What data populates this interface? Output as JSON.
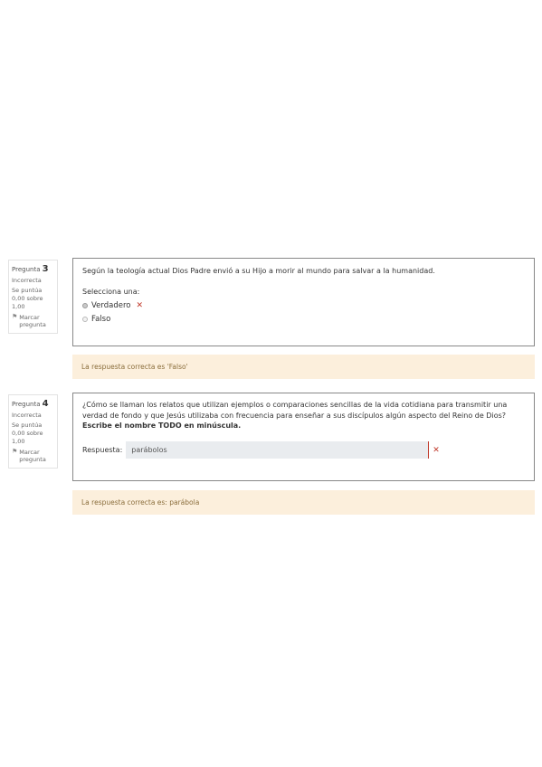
{
  "questions": [
    {
      "title_word": "Pregunta",
      "number": "3",
      "state": "Incorrecta",
      "grade": "Se puntúa 0,00 sobre 1,00",
      "flag_label": "Marcar pregunta",
      "text": "Según la teología actual Dios Padre envió a su Hijo a morir al mundo para salvar a la humanidad.",
      "prompt": "Selecciona una:",
      "options": [
        {
          "label": "Verdadero",
          "selected": true,
          "marked_wrong": true
        },
        {
          "label": "Falso",
          "selected": false,
          "marked_wrong": false
        }
      ],
      "feedback": "La respuesta correcta es 'Falso'"
    },
    {
      "title_word": "Pregunta",
      "number": "4",
      "state": "Incorrecta",
      "grade": "Se puntúa 0,00 sobre 1,00",
      "flag_label": "Marcar pregunta",
      "text_plain": "¿Cómo se llaman los relatos que utilizan ejemplos o comparaciones sencillas de la vida cotidiana para transmitir una verdad de fondo y que Jesús utilizaba con frecuencia para enseñar a sus discípulos algún aspecto del Reino de Dios? ",
      "text_bold": "Escribe el nombre TODO en minúscula.",
      "answer_label": "Respuesta:",
      "answer_value": "parábolos",
      "feedback": "La respuesta correcta es: parábola"
    }
  ],
  "icons": {
    "flag": "flag-icon",
    "wrong": "x-mark-icon"
  },
  "colors": {
    "feedback_bg": "#fcefdc",
    "feedback_text": "#8a6d3b",
    "wrong": "#c0392b",
    "input_bg": "#e9ecef"
  }
}
